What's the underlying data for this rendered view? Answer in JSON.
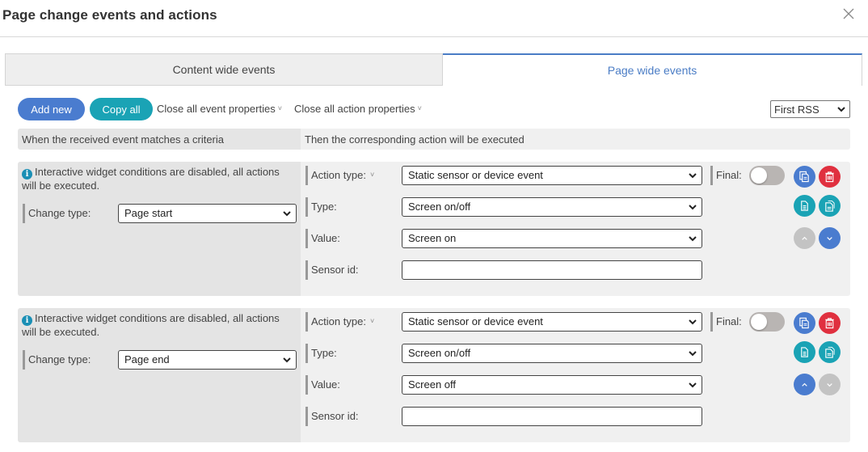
{
  "dialog": {
    "title": "Page change events and actions",
    "close_icon": "close-x-icon"
  },
  "tabs": [
    {
      "label": "Content wide events",
      "active": false
    },
    {
      "label": "Page wide events",
      "active": true
    }
  ],
  "toolbar": {
    "add_new_label": "Add new",
    "copy_all_label": "Copy all",
    "close_events_label": "Close all event properties",
    "close_actions_label": "Close all action properties",
    "chevron": "˅",
    "feed_select_value": "First RSS"
  },
  "columns": {
    "left": "When the received event matches a criteria",
    "right": "Then the corresponding action will be executed"
  },
  "colors": {
    "primary_blue": "#4a7ccf",
    "teal": "#1aa3b5",
    "danger_red": "#e0303f",
    "disabled_grey": "#c3c3c3",
    "info_blue": "#1a8fb5"
  },
  "rules": [
    {
      "info_icon": "i",
      "info_text": "Interactive widget conditions are disabled, all actions will be executed.",
      "change_type_label": "Change type:",
      "change_type_value": "Page start",
      "action_type_label": "Action type:",
      "action_type_value": "Static sensor or device event",
      "type_label": "Type:",
      "type_value": "Screen on/off",
      "value_label": "Value:",
      "value_value": "Screen on",
      "sensor_id_label": "Sensor id:",
      "sensor_id_value": "",
      "final_label": "Final:",
      "final_on": false,
      "move_up_enabled": false,
      "move_down_enabled": true
    },
    {
      "info_icon": "i",
      "info_text": "Interactive widget conditions are disabled, all actions will be executed.",
      "change_type_label": "Change type:",
      "change_type_value": "Page end",
      "action_type_label": "Action type:",
      "action_type_value": "Static sensor or device event",
      "type_label": "Type:",
      "type_value": "Screen on/off",
      "value_label": "Value:",
      "value_value": "Screen off",
      "sensor_id_label": "Sensor id:",
      "sensor_id_value": "",
      "final_label": "Final:",
      "final_on": false,
      "move_up_enabled": true,
      "move_down_enabled": false
    }
  ]
}
